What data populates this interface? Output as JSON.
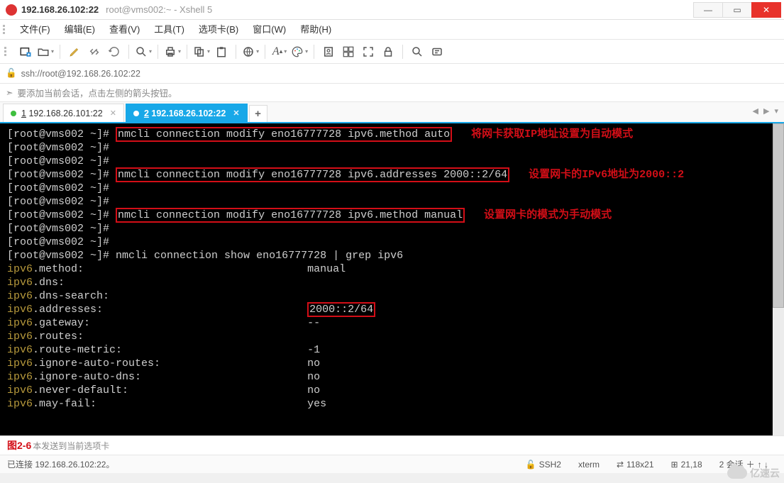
{
  "title": {
    "host": "192.168.26.102:22",
    "sub": "root@vms002:~ - Xshell 5"
  },
  "menus": [
    "文件(F)",
    "编辑(E)",
    "查看(V)",
    "工具(T)",
    "选项卡(B)",
    "窗口(W)",
    "帮助(H)"
  ],
  "toolbar_icons": {
    "new": "new-session-icon",
    "open": "open-icon",
    "pencil": "edit-icon",
    "disconnect": "disconnect-icon",
    "reconnect": "reconnect-icon",
    "search": "search-icon",
    "print": "print-icon",
    "copy": "copy-icon",
    "paste": "paste-icon",
    "globe": "globe-icon",
    "font": "font-icon",
    "palette": "palette-icon",
    "addressbook": "addressbook-icon",
    "sendall": "sendall-icon",
    "fullscreen": "fullscreen-icon",
    "lock": "lock-icon",
    "zoom": "zoom-icon",
    "macro": "macro-icon"
  },
  "addressbar": {
    "url": "ssh://root@192.168.26.102:22"
  },
  "hint": "要添加当前会话，点击左侧的箭头按钮。",
  "tabs": [
    {
      "label": "1 192.168.26.101:22",
      "active": false
    },
    {
      "label": "2 192.168.26.102:22",
      "active": true
    }
  ],
  "tab_scrollers": "◀ ▶ ▾",
  "term": {
    "prompt": "[root@vms002 ~]# ",
    "cmd1": "nmcli connection modify eno16777728 ipv6.method auto",
    "ann1": "将网卡获取IP地址设置为自动模式",
    "cmd2": "nmcli connection modify eno16777728 ipv6.addresses 2000::2/64",
    "ann2": "设置网卡的IPv6地址为2000::2",
    "cmd3": "nmcli connection modify eno16777728 ipv6.method manual",
    "ann3": "设置网卡的模式为手动模式",
    "cmd4": "nmcli connection show eno16777728 | grep ipv6",
    "out": [
      {
        "k": "ipv6",
        "rest": ".method:",
        "v": "manual"
      },
      {
        "k": "ipv6",
        "rest": ".dns:",
        "v": ""
      },
      {
        "k": "ipv6",
        "rest": ".dns-search:",
        "v": ""
      },
      {
        "k": "ipv6",
        "rest": ".addresses:",
        "v": "2000::2/64",
        "boxed": true
      },
      {
        "k": "ipv6",
        "rest": ".gateway:",
        "v": "--"
      },
      {
        "k": "ipv6",
        "rest": ".routes:",
        "v": ""
      },
      {
        "k": "ipv6",
        "rest": ".route-metric:",
        "v": "-1"
      },
      {
        "k": "ipv6",
        "rest": ".ignore-auto-routes:",
        "v": "no"
      },
      {
        "k": "ipv6",
        "rest": ".ignore-auto-dns:",
        "v": "no"
      },
      {
        "k": "ipv6",
        "rest": ".never-default:",
        "v": "no"
      },
      {
        "k": "ipv6",
        "rest": ".may-fail:",
        "v": "yes"
      }
    ]
  },
  "footer": {
    "figure_label": "图2-6",
    "placeholder": "本发送到当前选项卡"
  },
  "status": {
    "left": "已连接 192.168.26.102:22。",
    "ssh": "SSH2",
    "term": "xterm",
    "size": "118x21",
    "pos": "21,18",
    "sessions": "2 会话",
    "size_icon": "⇄",
    "grid_icon": "⊞",
    "plus_icon": "＋",
    "arrows_icon": "↑ ↓"
  },
  "watermark": "亿速云"
}
